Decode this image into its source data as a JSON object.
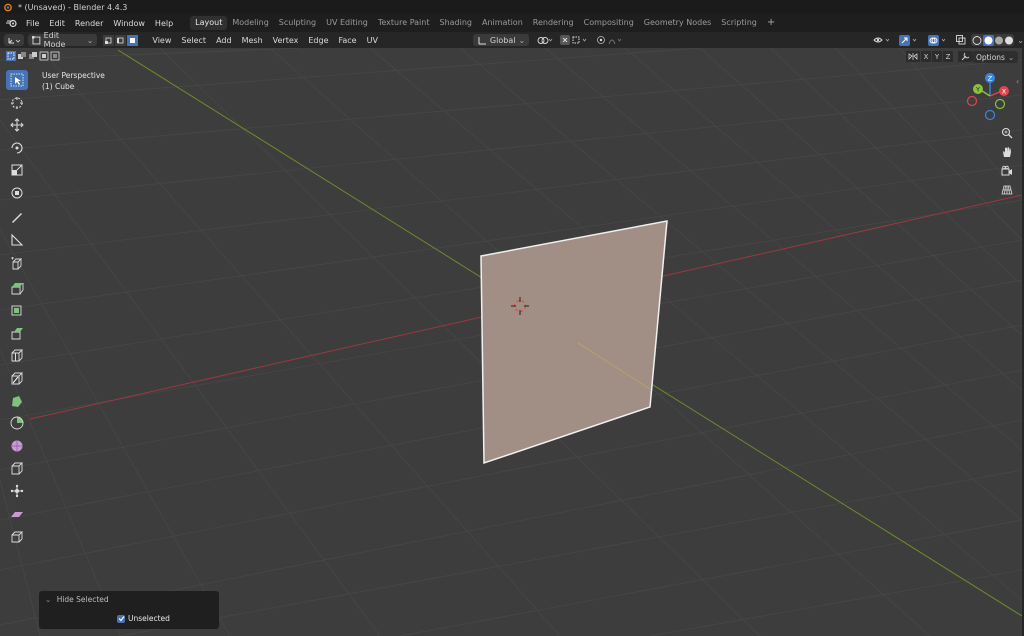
{
  "window": {
    "title": "* (Unsaved) - Blender 4.4.3"
  },
  "menu": {
    "items": [
      "File",
      "Edit",
      "Render",
      "Window",
      "Help"
    ]
  },
  "workspaces": {
    "tabs": [
      "Layout",
      "Modeling",
      "Sculpting",
      "UV Editing",
      "Texture Paint",
      "Shading",
      "Animation",
      "Rendering",
      "Compositing",
      "Geometry Nodes",
      "Scripting"
    ],
    "active": "Layout",
    "add": "+"
  },
  "header": {
    "mode": "Edit Mode",
    "menus": [
      "View",
      "Select",
      "Add",
      "Mesh",
      "Vertex",
      "Edge",
      "Face",
      "UV"
    ],
    "orientation": "Global",
    "options": "Options",
    "axes": [
      "X",
      "Y",
      "Z"
    ]
  },
  "viewport": {
    "perspective": "User Perspective",
    "object": "(1) Cube"
  },
  "gizmo": {
    "x": "X",
    "y": "Y",
    "z": "Z"
  },
  "operator_panel": {
    "title": "Hide Selected",
    "checkbox_label": "Unselected",
    "checked": true
  },
  "colors": {
    "accent": "#4772b3",
    "x_axis": "#e2434f",
    "y_axis": "#8ac33a",
    "z_axis": "#3a86e2",
    "face": "#a18f85"
  }
}
